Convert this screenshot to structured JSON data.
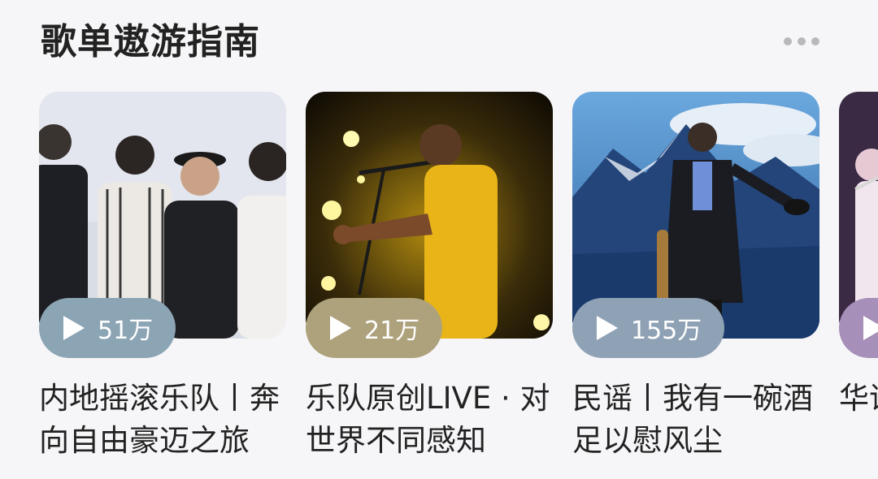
{
  "section": {
    "title": "歌单遨游指南",
    "more_icon": "more-dots-icon"
  },
  "playlists": [
    {
      "title": "内地摇滚乐队丨奔向自由豪迈之旅",
      "play_count": "51万",
      "pill_color": "#8ba5b5",
      "icon": "play-icon"
    },
    {
      "title": "乐队原创LIVE · 对世界不同感知",
      "play_count": "21万",
      "pill_color": "#aea27c",
      "icon": "play-icon"
    },
    {
      "title": "民谣丨我有一碗酒足以慰风尘",
      "play_count": "155万",
      "pill_color": "#8fa2b5",
      "icon": "play-icon"
    },
    {
      "title": "华语着",
      "play_count": "",
      "pill_color": "#a68fb8",
      "icon": "play-icon"
    }
  ]
}
